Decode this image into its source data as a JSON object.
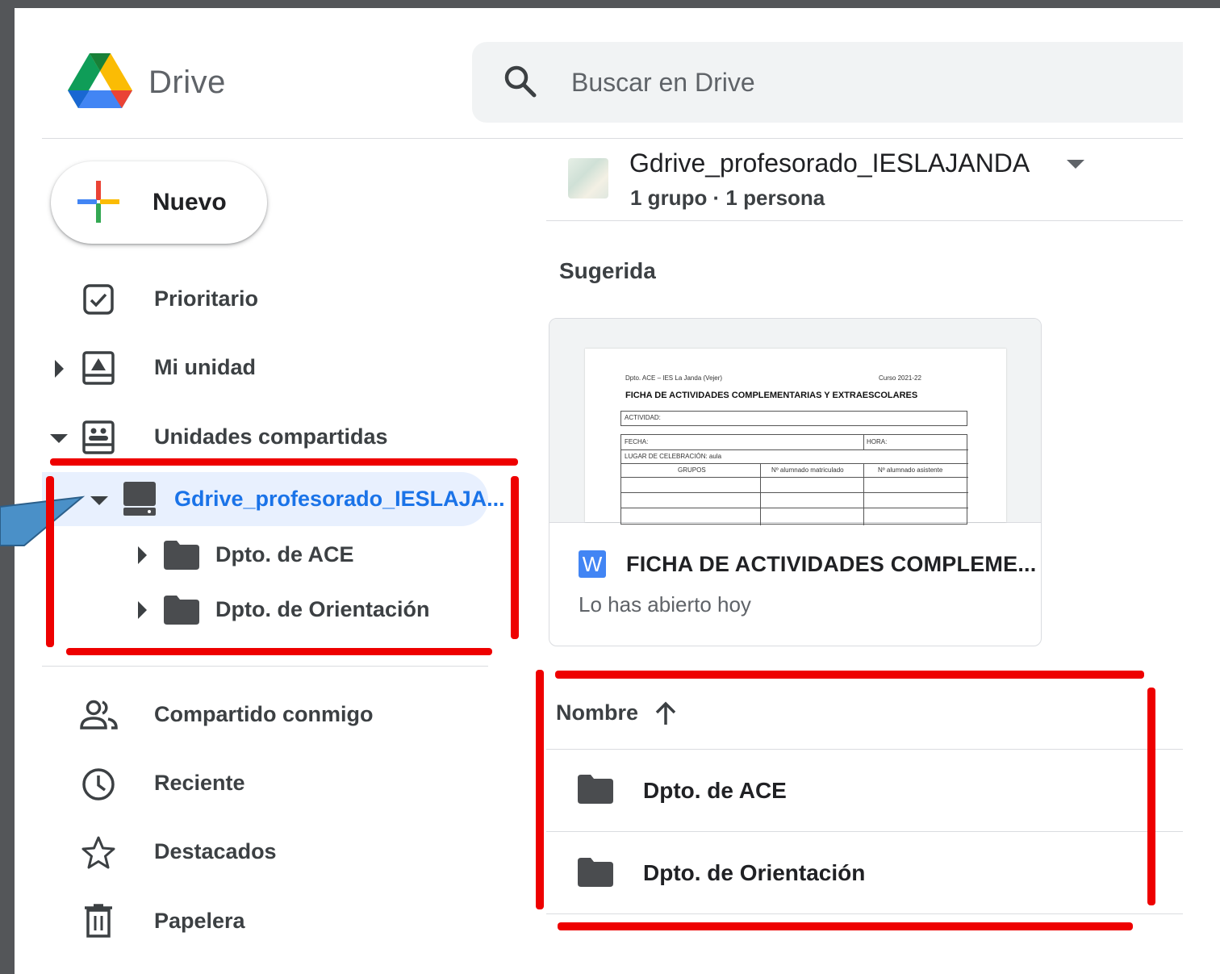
{
  "app": {
    "title": "Drive"
  },
  "search": {
    "placeholder": "Buscar en Drive"
  },
  "sidebar": {
    "new_label": "Nuevo",
    "items": [
      {
        "label": "Prioritario",
        "icon": "priority-icon"
      },
      {
        "label": "Mi unidad",
        "icon": "my-drive-icon"
      },
      {
        "label": "Unidades compartidas",
        "icon": "shared-drives-icon"
      }
    ],
    "shared_drive": {
      "label": "Gdrive_profesorado_IESLAJA...",
      "icon": "shared-drive-icon"
    },
    "subfolders": [
      {
        "label": "Dpto. de ACE"
      },
      {
        "label": "Dpto. de Orientación"
      }
    ],
    "bottom_items": [
      {
        "label": "Compartido conmigo",
        "icon": "shared-with-me-icon"
      },
      {
        "label": "Reciente",
        "icon": "clock-icon"
      },
      {
        "label": "Destacados",
        "icon": "star-icon"
      },
      {
        "label": "Papelera",
        "icon": "trash-icon"
      }
    ]
  },
  "drive_header": {
    "name": "Gdrive_profesorado_IESLAJANDA",
    "members": "1 grupo · 1 persona"
  },
  "suggested": {
    "heading": "Sugerida",
    "card": {
      "title": "FICHA DE ACTIVIDADES COMPLEME...",
      "subtitle": "Lo has abierto hoy",
      "file_badge": "W",
      "preview": {
        "header_left": "Dpto. ACE – IES La Janda (Vejer)",
        "header_right": "Curso 2021-22",
        "title": "FICHA DE ACTIVIDADES COMPLEMENTARIAS Y EXTRAESCOLARES",
        "actividad": "ACTIVIDAD:",
        "fecha": "FECHA:",
        "hora": "HORA:",
        "lugar": "LUGAR DE CELEBRACIÓN: aula",
        "col_grupos": "GRUPOS",
        "col_matriculado": "Nº alumnado matriculado",
        "col_asistente": "Nº alumnado asistente"
      }
    }
  },
  "list": {
    "column_name": "Nombre",
    "rows": [
      {
        "name": "Dpto. de ACE"
      },
      {
        "name": "Dpto. de Orientación"
      }
    ]
  },
  "colors": {
    "annotation_red": "#ee0000",
    "accent_blue": "#1a73e8",
    "active_bg": "#e8f0fe"
  }
}
